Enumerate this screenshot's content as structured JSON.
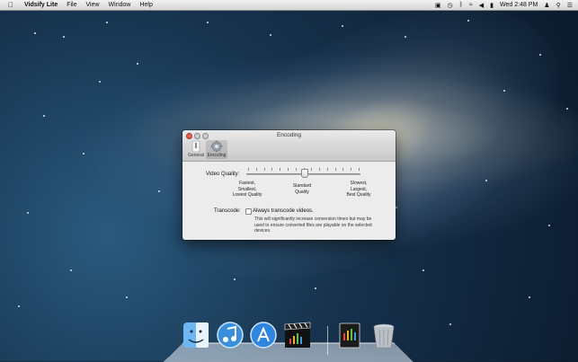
{
  "menubar": {
    "apple_icon": "apple-logo-icon",
    "app_name": "Vidsify Lite",
    "menus": [
      "File",
      "View",
      "Window",
      "Help"
    ],
    "clock": "Wed 2:48 PM",
    "status_icons": [
      "display-icon",
      "time-machine-icon",
      "bluetooth-icon",
      "wifi-icon",
      "volume-icon",
      "battery-icon",
      "user-icon",
      "spotlight-icon",
      "list-icon"
    ]
  },
  "window": {
    "title": "Encoding",
    "tabs": [
      {
        "label": "General",
        "icon": "general-icon"
      },
      {
        "label": "Encoding",
        "icon": "gear-icon"
      }
    ],
    "video_quality": {
      "label": "Video Quality:",
      "level_fraction": 0.5,
      "left_caption": "Fastest,\nSmallest,\nLowest Quality",
      "mid_caption": "Standard\nQuality",
      "right_caption": "Slowest,\nLargest,\nBest Quality"
    },
    "transcode": {
      "label": "Transcode:",
      "checkbox_label": "Always transcode videos.",
      "checked": false,
      "note": "This will significantly increase conversion times but may be used to ensure converted files are playable on the selected devices."
    }
  },
  "dock": {
    "items": [
      "finder-icon",
      "itunes-icon",
      "app-store-icon",
      "vidsify-lite-icon",
      "document-icon",
      "trash-icon"
    ]
  }
}
